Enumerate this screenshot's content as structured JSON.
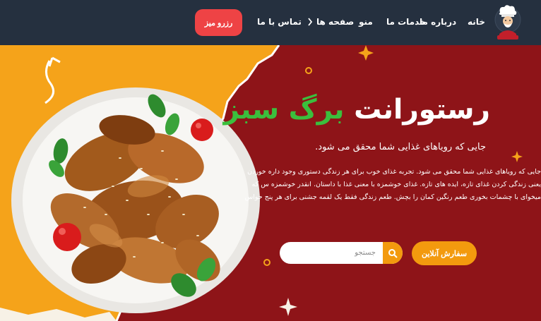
{
  "brand": {
    "logo_icon": "chef-logo-icon"
  },
  "nav": {
    "items": [
      {
        "label": "خانه"
      },
      {
        "label": "درباره ما"
      },
      {
        "label": "خدمات ما"
      },
      {
        "label": "منو"
      },
      {
        "label": "صفحه ها",
        "icon": "chevron-icon"
      },
      {
        "label": "تماس با ما"
      }
    ],
    "reserve_button": "رزرو میز"
  },
  "hero": {
    "title_part1": "رستورانت",
    "title_accent": "برگ سبز",
    "subtitle": "جایی که رویاهای غذایی شما محقق می شود.",
    "description": "جایی که رویاهای غذایی شما محقق می شود. تجربه غذای خوب برای هر زندگی دستوری وجود داره خوردن یعنی زندگی کردن غذای تازه، ایده های تازه. غذای خوشمزه با معنی غذا با داستان. انقدر خوشمزه س که میخوای با چشمات بخوری طعم رنگین کمان را بچش. طعم زندگی فقط یک لقمه جشنی برای هر پنج حواس",
    "order_button": "سفارش آنلاین",
    "search_placeholder": "جستجو",
    "search_icon": "search-icon",
    "image": "chicken-wings-plate"
  },
  "colors": {
    "navbar": "#25303f",
    "hero_left": "#f5a31a",
    "hero_right": "#8e1418",
    "accent_green": "#3bbf3d",
    "button_red": "#ee4345",
    "button_orange": "#f39a0e"
  }
}
